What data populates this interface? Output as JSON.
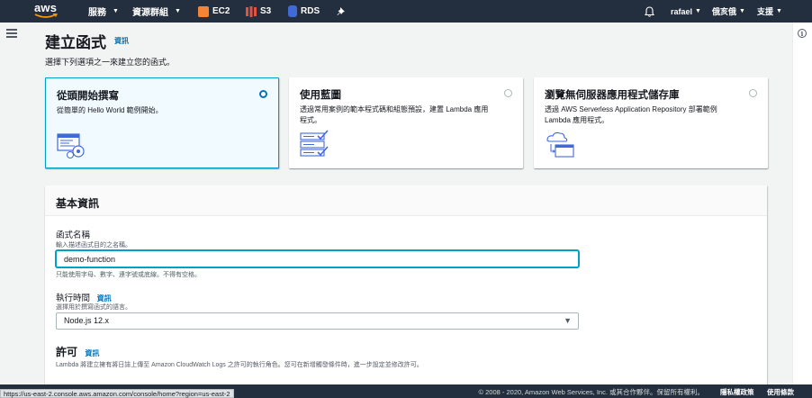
{
  "nav": {
    "logo": "aws",
    "services": "服務",
    "resource_groups": "資源群組",
    "ec2": "EC2",
    "s3": "S3",
    "rds": "RDS",
    "user": "rafael",
    "region": "俄亥俄",
    "support": "支援",
    "colors": {
      "ec2": "#f58536",
      "s3": "#e05243",
      "rds": "#3f6ad8"
    }
  },
  "header": {
    "title": "建立函式",
    "info": "資訊",
    "subtitle": "選擇下列選項之一來建立您的函式。"
  },
  "options": [
    {
      "title": "從頭開始撰寫",
      "desc": "從簡單的 Hello World 範例開始。",
      "selected": true,
      "icon": "author-from-scratch-icon"
    },
    {
      "title": "使用藍圖",
      "desc": "透過常用案例的範本程式碼和組態預設，建置 Lambda 應用程式。",
      "selected": false,
      "icon": "blueprint-icon"
    },
    {
      "title": "瀏覽無伺服器應用程式儲存庫",
      "desc": "透過 AWS Serverless Application Repository 部署範例 Lambda 應用程式。",
      "selected": false,
      "icon": "serverless-repo-icon"
    }
  ],
  "basic_info": {
    "title": "基本資訊",
    "function_name_label": "函式名稱",
    "function_name_desc": "輸入描述函式目的之名稱。",
    "function_name_value": "demo-function",
    "function_name_hint": "只能使用字母、數字、連字號或底線。不得有空格。",
    "runtime_label": "執行時間",
    "runtime_info": "資訊",
    "runtime_desc": "選擇用於撰寫函式的語言。",
    "runtime_value": "Node.js 12.x",
    "permissions_title": "許可",
    "permissions_info": "資訊",
    "permissions_desc": "Lambda 將建立擁有將日誌上傳至 Amazon CloudWatch Logs 之許可的執行角色。您可在新增觸發條件時，進一步設定並修改許可。"
  },
  "footer": {
    "copyright": "© 2008 - 2020, Amazon Web Services, Inc. 或其合作夥伴。保留所有權利。",
    "privacy": "隱私權政策",
    "terms": "使用條款",
    "status_url": "https://us-east-2.console.aws.amazon.com/console/home?region=us-east-2"
  }
}
